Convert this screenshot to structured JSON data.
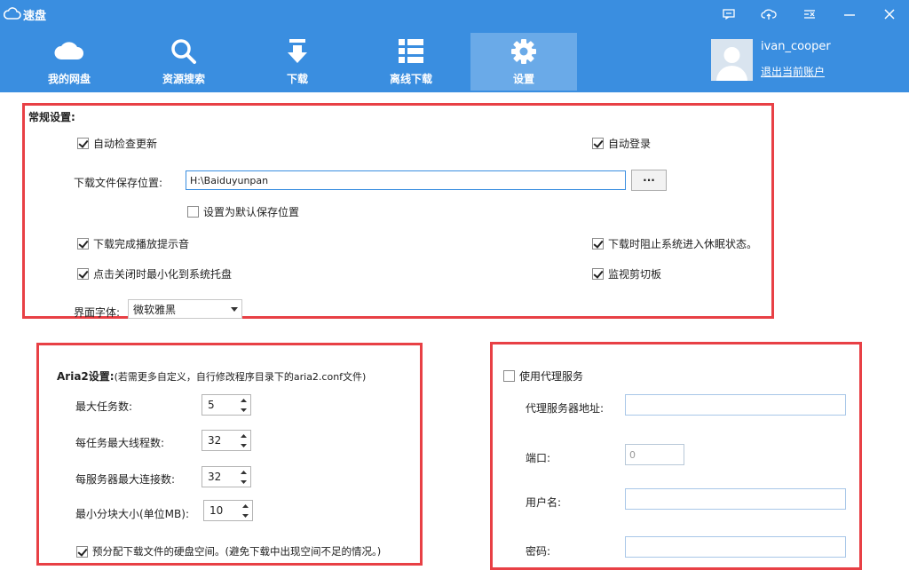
{
  "app": {
    "title": "速盘"
  },
  "window_controls": [
    "feedback-icon",
    "upload-cloud-icon",
    "menu-icon",
    "minimize-icon",
    "close-icon"
  ],
  "nav": {
    "items": [
      {
        "label": "我的网盘",
        "icon": "cloud-icon",
        "active": false
      },
      {
        "label": "资源搜索",
        "icon": "search-icon",
        "active": false
      },
      {
        "label": "下载",
        "icon": "download-arrow-icon",
        "active": false
      },
      {
        "label": "离线下载",
        "icon": "list-icon",
        "active": false
      },
      {
        "label": "设置",
        "icon": "gear-icon",
        "active": true
      }
    ]
  },
  "user": {
    "name": "ivan_cooper",
    "logout_label": "退出当前账户"
  },
  "general": {
    "title": "常规设置:",
    "auto_update": {
      "label": "自动检查更新",
      "checked": true
    },
    "auto_login": {
      "label": "自动登录",
      "checked": true
    },
    "save_path_label": "下载文件保存位置:",
    "save_path_value": "H:\\Baiduyunpan",
    "browse_label": "···",
    "set_default": {
      "label": "设置为默认保存位置",
      "checked": false
    },
    "play_sound": {
      "label": "下载完成播放提示音",
      "checked": true
    },
    "prevent_sleep": {
      "label": "下载时阻止系统进入休眠状态。",
      "checked": true
    },
    "minimize_tray": {
      "label": "点击关闭时最小化到系统托盘",
      "checked": true
    },
    "monitor_clipboard": {
      "label": "监视剪切板",
      "checked": true
    },
    "font_label": "界面字体:",
    "font_value": "微软雅黑"
  },
  "aria2": {
    "title": "Aria2设置:",
    "note": "(若需更多自定义，自行修改程序目录下的aria2.conf文件)",
    "max_tasks": {
      "label": "最大任务数:",
      "value": "5"
    },
    "max_threads": {
      "label": "每任务最大线程数:",
      "value": "32"
    },
    "max_conn": {
      "label": "每服务器最大连接数:",
      "value": "32"
    },
    "min_split": {
      "label": "最小分块大小(单位MB):",
      "value": "10"
    },
    "prealloc": {
      "label": "预分配下载文件的硬盘空间。(避免下载中出现空间不足的情况。)",
      "checked": true
    }
  },
  "proxy": {
    "use_proxy": {
      "label": "使用代理服务",
      "checked": false
    },
    "address_label": "代理服务器地址:",
    "address_value": "",
    "port_label": "端口:",
    "port_value": "0",
    "username_label": "用户名:",
    "username_value": "",
    "password_label": "密码:",
    "password_value": ""
  },
  "colors": {
    "header": "#3a8ee0",
    "active_tab": "#6aaae8",
    "panel_border": "#e84045"
  }
}
